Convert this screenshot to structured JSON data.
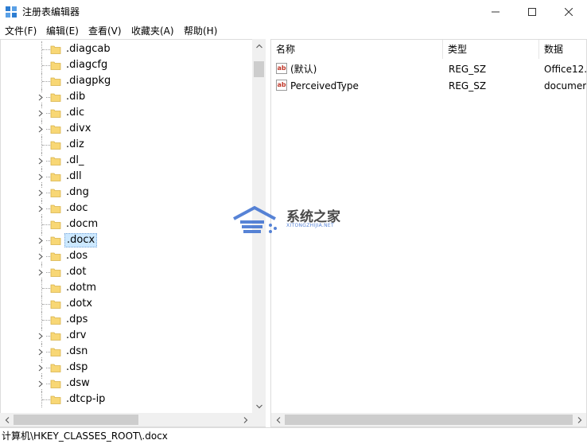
{
  "window": {
    "title": "注册表编辑器",
    "controls": [
      "minimize-icon",
      "maximize-icon",
      "close-icon"
    ]
  },
  "menu": {
    "items": [
      {
        "label": "文件(F)"
      },
      {
        "label": "编辑(E)"
      },
      {
        "label": "查看(V)"
      },
      {
        "label": "收藏夹(A)"
      },
      {
        "label": "帮助(H)"
      }
    ]
  },
  "tree": {
    "items": [
      {
        "label": ".diagcab",
        "expandable": false
      },
      {
        "label": ".diagcfg",
        "expandable": false
      },
      {
        "label": ".diagpkg",
        "expandable": false
      },
      {
        "label": ".dib",
        "expandable": true
      },
      {
        "label": ".dic",
        "expandable": true
      },
      {
        "label": ".divx",
        "expandable": true
      },
      {
        "label": ".diz",
        "expandable": false
      },
      {
        "label": ".dl_",
        "expandable": true
      },
      {
        "label": ".dll",
        "expandable": true
      },
      {
        "label": ".dng",
        "expandable": true
      },
      {
        "label": ".doc",
        "expandable": true
      },
      {
        "label": ".docm",
        "expandable": false
      },
      {
        "label": ".docx",
        "expandable": true,
        "selected": true
      },
      {
        "label": ".dos",
        "expandable": true
      },
      {
        "label": ".dot",
        "expandable": true
      },
      {
        "label": ".dotm",
        "expandable": false
      },
      {
        "label": ".dotx",
        "expandable": false
      },
      {
        "label": ".dps",
        "expandable": false
      },
      {
        "label": ".drv",
        "expandable": true
      },
      {
        "label": ".dsn",
        "expandable": true
      },
      {
        "label": ".dsp",
        "expandable": true
      },
      {
        "label": ".dsw",
        "expandable": true
      },
      {
        "label": ".dtcp-ip",
        "expandable": false
      }
    ]
  },
  "list": {
    "columns": [
      {
        "label": "名称"
      },
      {
        "label": "类型"
      },
      {
        "label": "数据"
      }
    ],
    "rows": [
      {
        "icon": "string-value-icon",
        "name": "(默认)",
        "type": "REG_SZ",
        "data": "Office12."
      },
      {
        "icon": "string-value-icon",
        "name": "PerceivedType",
        "type": "REG_SZ",
        "data": "documer"
      }
    ]
  },
  "status": {
    "path": "计算机\\HKEY_CLASSES_ROOT\\.docx"
  },
  "watermark": {
    "title": "系统之家",
    "subtitle": "XITONGZHIJIA.NET"
  },
  "colors": {
    "folder_fill": "#f8d775",
    "selection": "#cce8ff",
    "watermark_blue": "#3a6ed0"
  }
}
